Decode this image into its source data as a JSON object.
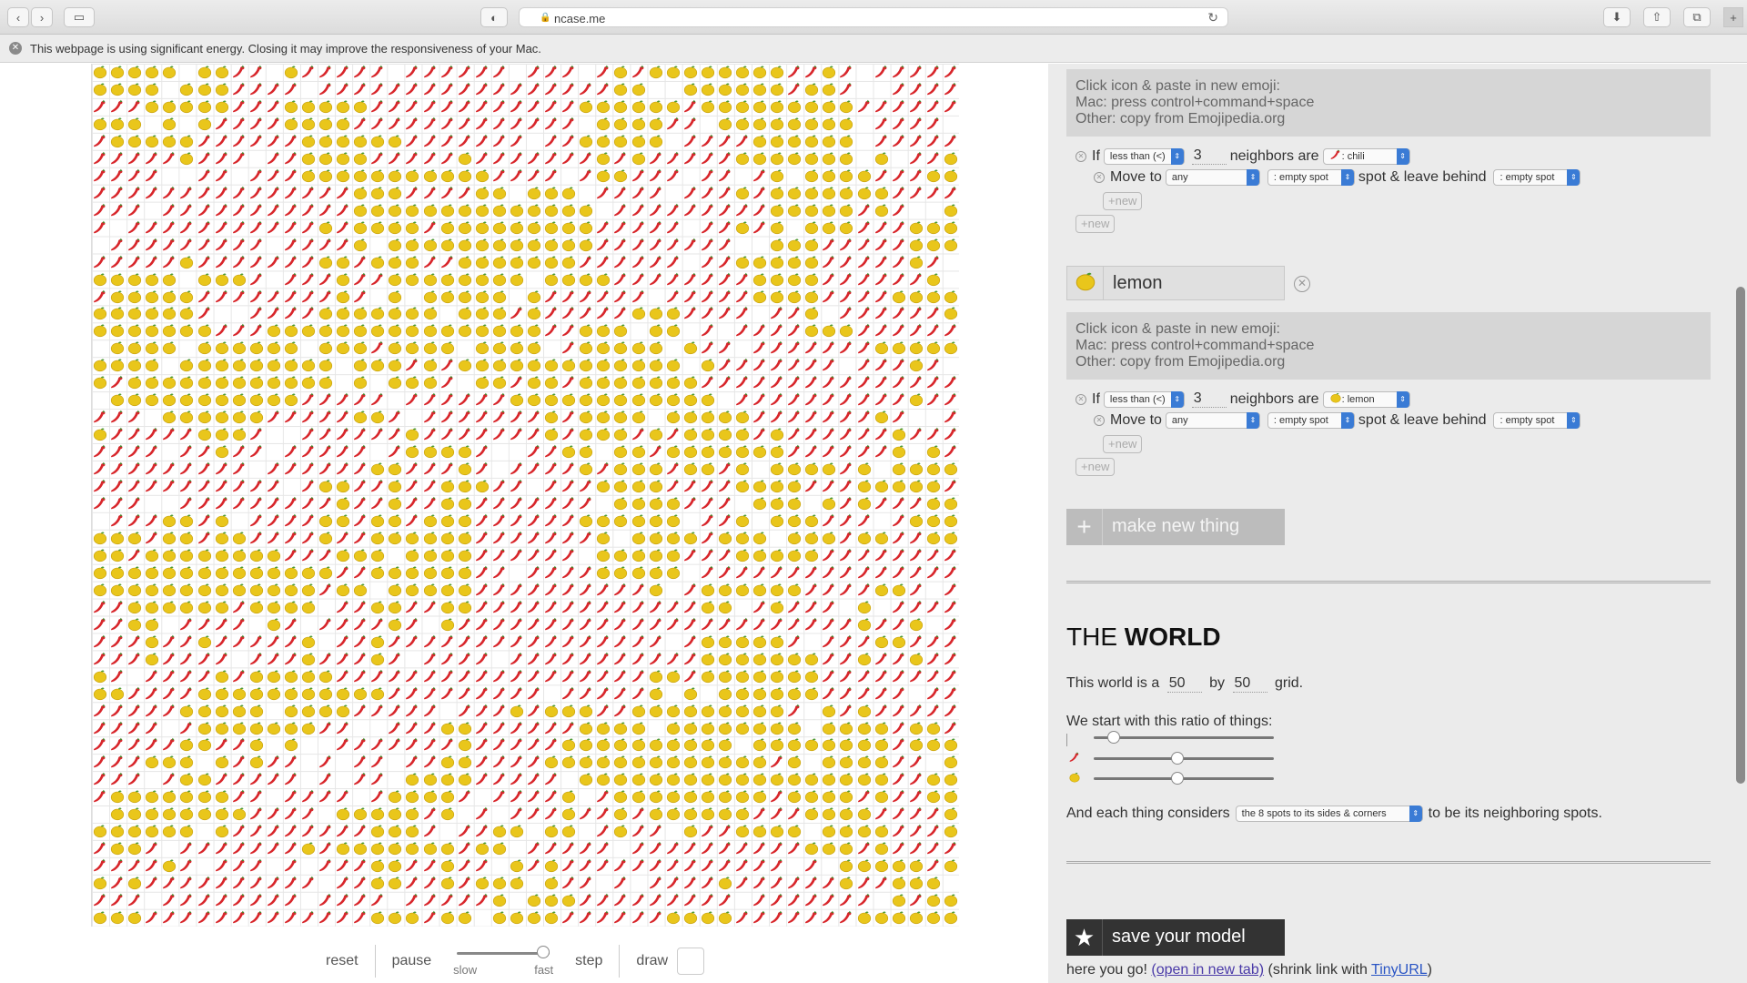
{
  "browser": {
    "url": "ncase.me",
    "energy_warning": "This webpage is using significant energy. Closing it may improve the responsiveness of your Mac."
  },
  "icons": {
    "chili": "chili-pepper-icon",
    "lemon": "lemon-icon",
    "close": "close-icon",
    "plus": "plus-icon",
    "star": "star-icon"
  },
  "colors": {
    "chili": "#d8262b",
    "lemon": "#e9c61b",
    "panel_bg": "#ebebeb",
    "select_arrow": "#3a7bd5"
  },
  "simulation": {
    "controls": {
      "reset": "reset",
      "pause": "pause",
      "speed_slow": "slow",
      "speed_fast": "fast",
      "speed_value": 1.0,
      "step": "step",
      "draw": "draw"
    }
  },
  "editor": {
    "help": {
      "line1": "Click icon & paste in new emoji:",
      "line2": "Mac: press control+command+space",
      "line3": "Other: copy from Emojipedia.org"
    },
    "rule_words": {
      "if": "If",
      "neighbors_are": "neighbors are",
      "move_to": "Move to",
      "spot_leave_behind": "spot & leave behind",
      "new": "+new"
    },
    "chili_rule": {
      "comparator": "less than (<)",
      "count": "3",
      "neighbor": ": chili",
      "move_direction": "any",
      "move_target": ": empty spot",
      "leave_behind": ": empty spot"
    },
    "lemon_thing": {
      "name": "lemon"
    },
    "lemon_rule": {
      "comparator": "less than (<)",
      "count": "3",
      "neighbor": ": lemon",
      "move_direction": "any",
      "move_target": ": empty spot",
      "leave_behind": ": empty spot"
    },
    "make_new_thing": "make new thing"
  },
  "world": {
    "title_prefix": "THE",
    "title_bold": "WORLD",
    "size_prefix": "This world is a",
    "width": "50",
    "by": "by",
    "height": "50",
    "size_suffix": "grid.",
    "ratio_label": "We start with this ratio of things:",
    "ratios": {
      "empty": 0.08,
      "chili": 0.46,
      "lemon": 0.46
    },
    "neighbors_prefix": "And each thing considers",
    "neighbors_option": "the 8 spots to its sides & corners",
    "neighbors_suffix": "to be its neighboring spots."
  },
  "save": {
    "button": "save your model",
    "result_prefix": "here you go!",
    "open_link": "(open in new tab)",
    "shrink_prefix": "(shrink link with",
    "tinyurl": "TinyURL",
    "shrink_suffix": ")"
  }
}
